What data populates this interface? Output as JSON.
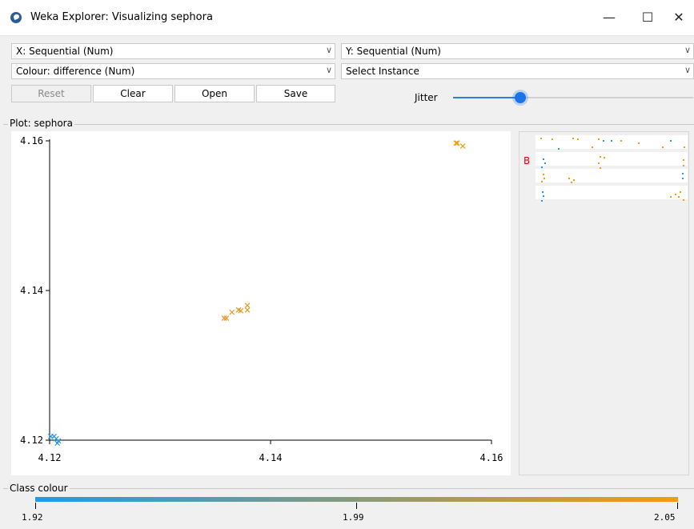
{
  "window": {
    "title": "Weka Explorer: Visualizing sephora",
    "minimize": "—",
    "maximize": "☐",
    "close": "✕"
  },
  "controls": {
    "x_axis": "X: Sequential (Num)",
    "y_axis": "Y: Sequential (Num)",
    "colour": "Colour: difference (Num)",
    "select_instance": "Select Instance",
    "buttons": {
      "reset": "Reset",
      "clear": "Clear",
      "open": "Open",
      "save": "Save"
    },
    "jitter_label": "Jitter",
    "jitter_level": 0.28
  },
  "plot_label": "Plot: sephora",
  "class_colour_label": "Class colour",
  "chart_data": {
    "type": "scatter",
    "xlim": [
      4.12,
      4.16
    ],
    "ylim": [
      4.12,
      4.16
    ],
    "x_ticks": [
      "4.12",
      "4.14",
      "4.16"
    ],
    "y_ticks": [
      "4.16",
      "4.14",
      "4.12"
    ],
    "points": [
      {
        "x": 4.1201,
        "y": 4.1205,
        "c": 1.92
      },
      {
        "x": 4.1204,
        "y": 4.1205,
        "c": 1.93
      },
      {
        "x": 4.1206,
        "y": 4.1202,
        "c": 1.92
      },
      {
        "x": 4.1208,
        "y": 4.1199,
        "c": 1.93
      },
      {
        "x": 4.1207,
        "y": 4.1196,
        "c": 1.92
      },
      {
        "x": 4.1358,
        "y": 4.1363,
        "c": 2.04
      },
      {
        "x": 4.136,
        "y": 4.1363,
        "c": 2.04
      },
      {
        "x": 4.1365,
        "y": 4.1371,
        "c": 2.04
      },
      {
        "x": 4.1371,
        "y": 4.1374,
        "c": 2.04
      },
      {
        "x": 4.1373,
        "y": 4.1373,
        "c": 2.04
      },
      {
        "x": 4.1379,
        "y": 4.1374,
        "c": 2.04
      },
      {
        "x": 4.1379,
        "y": 4.138,
        "c": 2.04
      },
      {
        "x": 4.1568,
        "y": 4.1597,
        "c": 2.05
      },
      {
        "x": 4.1569,
        "y": 4.1597,
        "c": 2.05
      },
      {
        "x": 4.1574,
        "y": 4.1593,
        "c": 2.05
      }
    ]
  },
  "matrix": {
    "label": "B"
  },
  "class_scale": {
    "min_label": "1.92",
    "mid_label": "1.99",
    "max_label": "2.05",
    "colors": [
      "#1e9be8",
      "#f49a0f"
    ]
  }
}
